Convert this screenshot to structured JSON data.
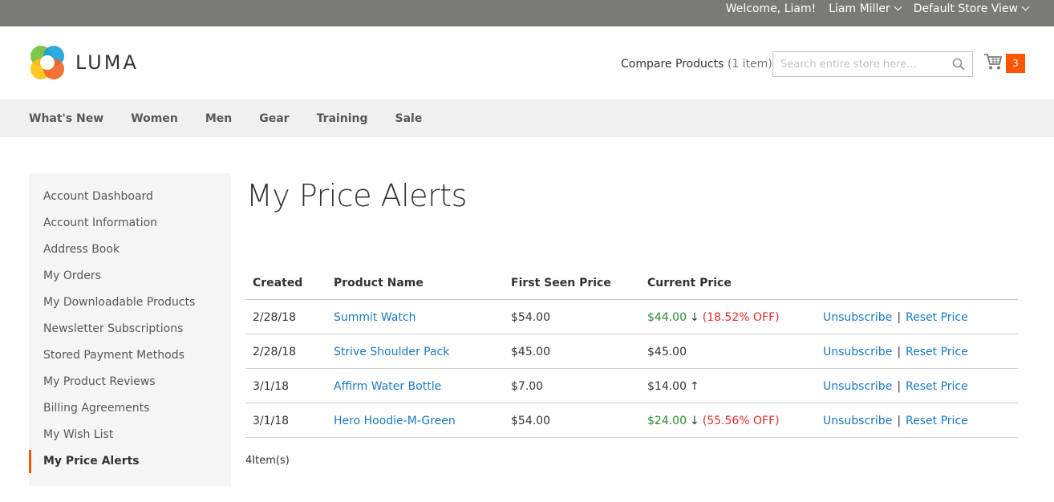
{
  "topbar": {
    "welcome": "Welcome, Liam!",
    "account": "Liam Miller",
    "store": "Default Store View"
  },
  "header": {
    "logo_text": "LUMA",
    "compare_label": "Compare Products",
    "compare_count": "(1 item)",
    "search_placeholder": "Search entire store here...",
    "cart_count": "3"
  },
  "nav": [
    "What's New",
    "Women",
    "Men",
    "Gear",
    "Training",
    "Sale"
  ],
  "sidebar": {
    "items": [
      "Account Dashboard",
      "Account Information",
      "Address Book",
      "My Orders",
      "My Downloadable Products",
      "Newsletter Subscriptions",
      "Stored Payment Methods",
      "My Product Reviews",
      "Billing Agreements",
      "My Wish List",
      "My Price Alerts"
    ],
    "active": "My Price Alerts"
  },
  "main": {
    "title": "My Price Alerts",
    "columns": [
      "Created",
      "Product Name",
      "First Seen Price",
      "Current Price"
    ],
    "rows": [
      {
        "created": "2/28/18",
        "product": "Summit Watch",
        "first_price": "$54.00",
        "current_price": "$44.00",
        "trend": "down",
        "arrow": "↓",
        "discount": "(18.52% OFF)",
        "unsubscribe": "Unsubscribe",
        "reset": "Reset Price"
      },
      {
        "created": "2/28/18",
        "product": "Strive Shoulder Pack",
        "first_price": "$45.00",
        "current_price": "$45.00",
        "trend": "same",
        "arrow": "",
        "discount": "",
        "unsubscribe": "Unsubscribe",
        "reset": "Reset Price"
      },
      {
        "created": "3/1/18",
        "product": "Affirm Water Bottle",
        "first_price": "$7.00",
        "current_price": "$14.00",
        "trend": "up",
        "arrow": "↑",
        "discount": "",
        "unsubscribe": "Unsubscribe",
        "reset": "Reset Price"
      },
      {
        "created": "3/1/18",
        "product": "Hero Hoodie-M-Green",
        "first_price": "$54.00",
        "current_price": "$24.00",
        "trend": "down",
        "arrow": "↓",
        "discount": "(55.56% OFF)",
        "unsubscribe": "Unsubscribe",
        "reset": "Reset Price"
      }
    ],
    "count_text": "4Item(s)"
  },
  "colors": {
    "accent": "#ff5501",
    "link": "#1979c3",
    "price_down": "#2e8b2e",
    "discount": "#e02b27",
    "topbar": "#7a7a77",
    "nav_bg": "#f0f0f0"
  },
  "icons": [
    "luma-logo-icon",
    "chevron-down-icon",
    "search-icon",
    "cart-icon"
  ]
}
